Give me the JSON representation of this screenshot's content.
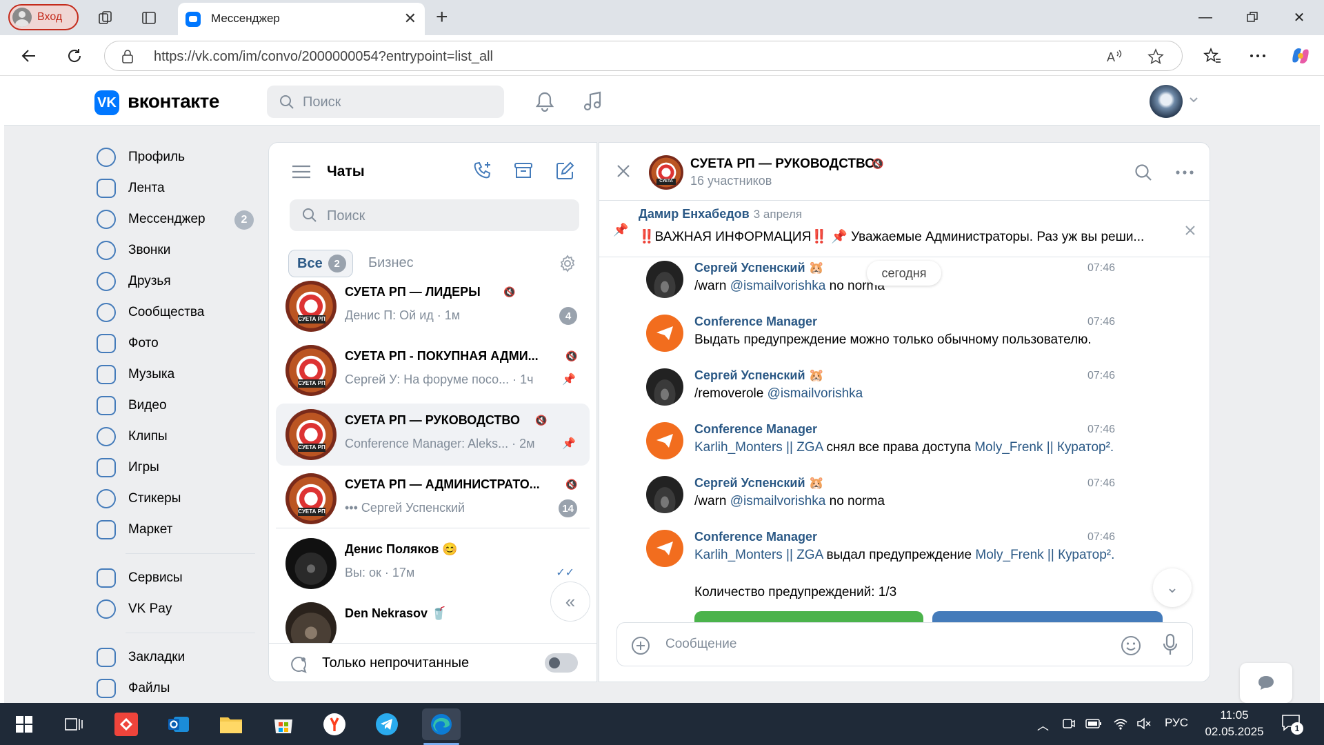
{
  "browser": {
    "profile_label": "Вход",
    "tab_title": "Мессенджер",
    "url": "https://vk.com/im/convo/2000000054?entrypoint=list_all"
  },
  "vk": {
    "logo_text": "вконтакте",
    "search_placeholder": "Поиск",
    "menu": [
      {
        "label": "Профиль",
        "icon": "profile-icon"
      },
      {
        "label": "Лента",
        "icon": "feed-icon"
      },
      {
        "label": "Мессенджер",
        "icon": "messenger-icon",
        "badge": "2"
      },
      {
        "label": "Звонки",
        "icon": "phone-icon"
      },
      {
        "label": "Друзья",
        "icon": "friends-icon"
      },
      {
        "label": "Сообщества",
        "icon": "communities-icon"
      },
      {
        "label": "Фото",
        "icon": "photo-icon"
      },
      {
        "label": "Музыка",
        "icon": "music-icon"
      },
      {
        "label": "Видео",
        "icon": "video-icon"
      },
      {
        "label": "Клипы",
        "icon": "clips-icon"
      },
      {
        "label": "Игры",
        "icon": "games-icon"
      },
      {
        "label": "Стикеры",
        "icon": "stickers-icon"
      },
      {
        "label": "Маркет",
        "icon": "market-icon"
      }
    ],
    "menu2": [
      {
        "label": "Сервисы",
        "icon": "services-icon"
      },
      {
        "label": "VK Pay",
        "icon": "vkpay-icon"
      }
    ],
    "menu3": [
      {
        "label": "Закладки",
        "icon": "bookmarks-icon"
      },
      {
        "label": "Файлы",
        "icon": "files-icon"
      }
    ]
  },
  "chats": {
    "title": "Чаты",
    "search_placeholder": "Поиск",
    "tab_all": "Все",
    "tab_all_count": "2",
    "tab_business": "Бизнес",
    "items": [
      {
        "name": "СУЕТА РП — ЛИДЕРЫ",
        "preview": "Денис П: Ой ид · 1м",
        "badge": "4",
        "muted": true
      },
      {
        "name": "СУЕТА РП - ПОКУПНАЯ АДМИ...",
        "preview": "Сергей У: На форуме посо... · 1ч",
        "pinned": true,
        "muted": true
      },
      {
        "name": "СУЕТА РП — РУКОВОДСТВО",
        "preview": "Conference Manager: Aleks... · 2м",
        "pinned": true,
        "muted": true,
        "selected": true
      },
      {
        "name": "СУЕТА РП — АДМИНИСТРАТО...",
        "preview": "••• Сергей Успенский",
        "badge": "14",
        "muted": true
      },
      {
        "name": "Денис Поляков 😊",
        "preview": "Вы: ок · 17м"
      },
      {
        "name": "Den Nekrasov 🥤",
        "preview": ""
      }
    ],
    "unread_only_label": "Только непрочитанные"
  },
  "conversation": {
    "title": "СУЕТА РП — РУКОВОДСТВО",
    "subtitle": "16 участников",
    "pinned_author": "Дамир Енхабедов",
    "pinned_date": "3 апреля",
    "pinned_text": "‼️ВАЖНАЯ ИНФОРМАЦИЯ‼️ 📌 Уважаемые Администраторы. Раз уж вы реши...",
    "day_label": "сегодня",
    "messages": [
      {
        "author": "Сергей Успенский 🐹",
        "time": "07:46",
        "pre": "/warn ",
        "link": "@ismailvorishka",
        "post": " no norma",
        "avatar": "sergey"
      },
      {
        "author": "Conference Manager",
        "time": "07:46",
        "pre": "Выдать предупреждение можно только обычному пользователю.",
        "link": "",
        "post": "",
        "avatar": "cm"
      },
      {
        "author": "Сергей Успенский 🐹",
        "time": "07:46",
        "pre": "/removerole ",
        "link": "@ismailvorishka",
        "post": "",
        "avatar": "sergey"
      },
      {
        "author": "Conference Manager",
        "time": "07:46",
        "pre": "",
        "link": "Karlih_Monters || ZGA",
        "post": " снял все права доступа ",
        "link2": "Moly_Frenk || Куратор².",
        "avatar": "cm"
      },
      {
        "author": "Сергей Успенский 🐹",
        "time": "07:46",
        "pre": "/warn ",
        "link": "@ismailvorishka",
        "post": " no norma",
        "avatar": "sergey"
      },
      {
        "author": "Conference Manager",
        "time": "07:46",
        "pre": "",
        "link": "Karlih_Monters || ZGA",
        "post": " выдал предупреждение ",
        "link2": "Moly_Frenk || Куратор².",
        "extra": "Количество предупреждений: 1/3",
        "avatar": "cm"
      }
    ],
    "composer_placeholder": "Сообщение"
  },
  "taskbar": {
    "lang": "РУС",
    "time": "11:05",
    "date": "02.05.2025",
    "notif_count": "1"
  },
  "colors": {
    "vk_blue": "#0077ff",
    "link": "#2a5885",
    "accent_orange": "#f26d1e"
  }
}
